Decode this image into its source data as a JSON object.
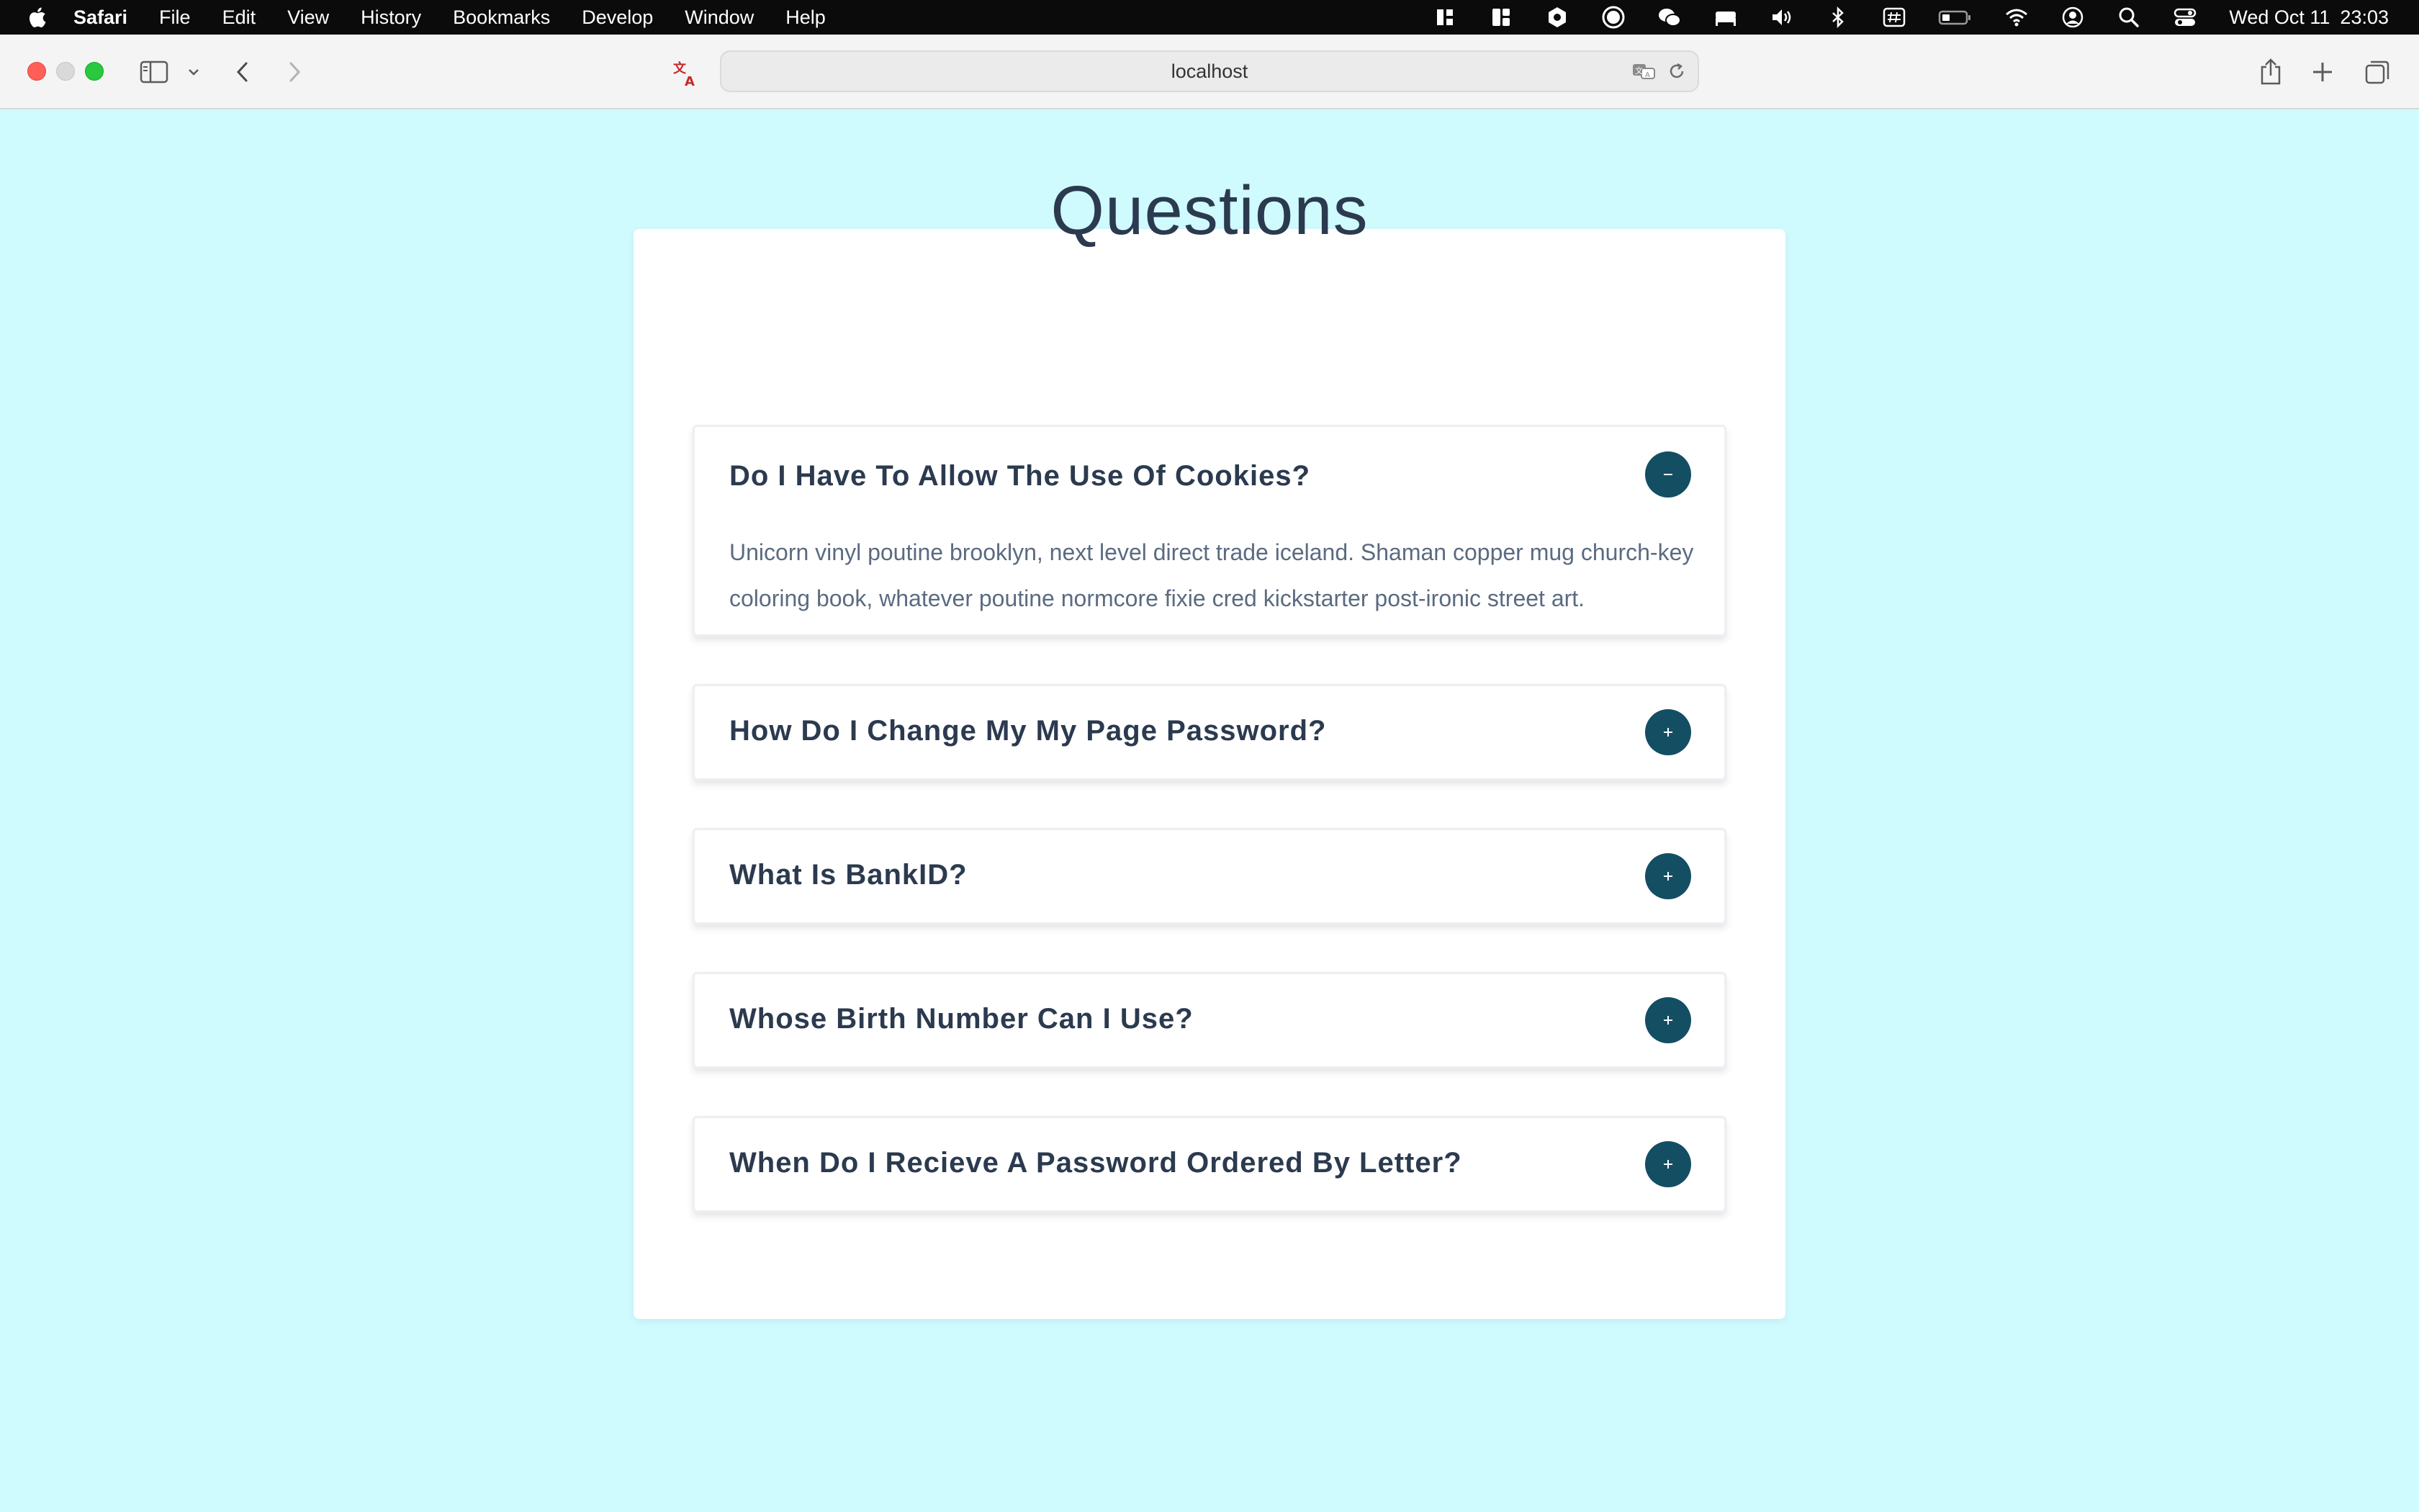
{
  "menubar": {
    "app_name": "Safari",
    "items": [
      "File",
      "Edit",
      "View",
      "History",
      "Bookmarks",
      "Develop",
      "Window",
      "Help"
    ],
    "clock": {
      "date": "Wed Oct 11",
      "time": "23:03"
    },
    "status_icons": [
      "grid-apps-icon",
      "dashboard-icon",
      "hexagon-icon",
      "record-icon",
      "wechat-icon",
      "bed-icon",
      "volume-icon",
      "bluetooth-icon",
      "hashtag-icon",
      "battery-icon",
      "wifi-icon",
      "user-account-icon",
      "spotlight-search-icon",
      "control-center-icon"
    ]
  },
  "browser": {
    "url": "localhost"
  },
  "page": {
    "title": "Questions",
    "faqs": [
      {
        "question": "Do I Have To Allow The Use Of Cookies?",
        "answer": "Unicorn vinyl poutine brooklyn, next level direct trade iceland. Shaman copper mug church-key coloring book, whatever poutine normcore fixie cred kickstarter post-ironic street art.",
        "expanded": true,
        "toggle": "−"
      },
      {
        "question": "How Do I Change My My Page Password?",
        "expanded": false,
        "toggle": "+"
      },
      {
        "question": "What Is BankID?",
        "expanded": false,
        "toggle": "+"
      },
      {
        "question": "Whose Birth Number Can I Use?",
        "expanded": false,
        "toggle": "+"
      },
      {
        "question": "When Do I Recieve A Password Ordered By Letter?",
        "expanded": false,
        "toggle": "+"
      }
    ]
  },
  "colors": {
    "page_background": "#cffafe",
    "heading": "#2b3a4f",
    "body_text": "#5b6b80",
    "toggle_button": "#134e63"
  }
}
